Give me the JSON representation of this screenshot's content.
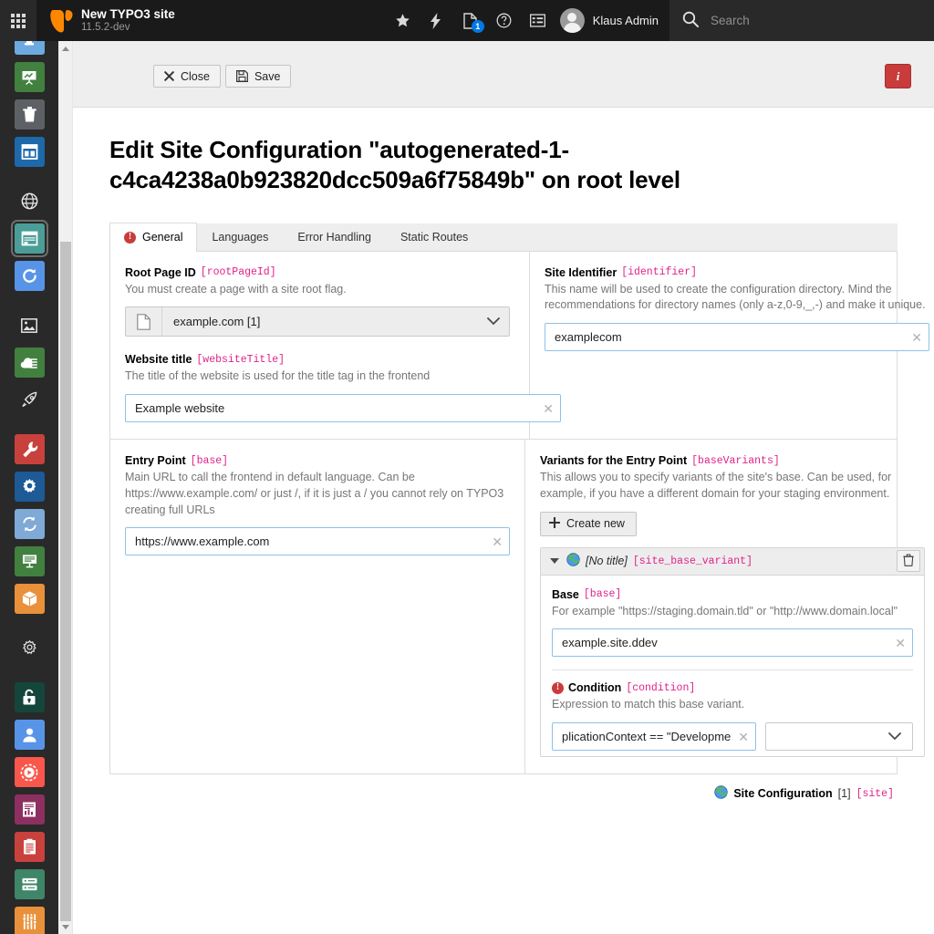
{
  "topbar": {
    "module_menu_icon": "grid-icon",
    "logo_icon": "typo3-logo-icon",
    "site_name": "New TYPO3 site",
    "version": "11.5.2-dev",
    "icons": [
      {
        "name": "bookmark-star-icon",
        "glyph": "star"
      },
      {
        "name": "flash-message-icon",
        "glyph": "bolt"
      },
      {
        "name": "clipboard-icon",
        "glyph": "document",
        "badge": "1"
      },
      {
        "name": "help-icon",
        "glyph": "question-circle"
      },
      {
        "name": "list-icon",
        "glyph": "list"
      }
    ],
    "user_name": "Klaus Admin",
    "avatar_name": "avatar",
    "search_icon": "search-icon",
    "search_placeholder": "Search",
    "search_value": ""
  },
  "modulemenu": {
    "items": [
      {
        "name": "module-web-page",
        "icon": "page-icon",
        "bg": "#6daae0",
        "active": false
      },
      {
        "name": "module-web-view",
        "icon": "presentation-icon",
        "bg": "#41803f",
        "active": false
      },
      {
        "name": "module-recycler",
        "icon": "trash-icon",
        "bg": "#5d6166",
        "active": false
      },
      {
        "name": "module-page-layout",
        "icon": "layout-icon",
        "bg": "#1d69aa",
        "active": false
      },
      {
        "name": "module-site-globe",
        "icon": "globe-icon",
        "bg": "transparent",
        "active": false
      },
      {
        "name": "module-site-management",
        "icon": "site-icon",
        "bg": "#4a9e97",
        "active": true
      },
      {
        "name": "module-redirects",
        "icon": "refresh-icon",
        "bg": "#5794e8",
        "active": false
      },
      {
        "name": "module-filelist-media",
        "icon": "image-icon",
        "bg": "transparent",
        "active": false
      },
      {
        "name": "module-filelist",
        "icon": "cloud-files-icon",
        "bg": "#41803f",
        "active": false
      },
      {
        "name": "module-upgrade",
        "icon": "rocket-icon",
        "bg": "transparent",
        "active": false
      },
      {
        "name": "module-maintenance",
        "icon": "wrench-icon",
        "bg": "#c9413d",
        "active": false
      },
      {
        "name": "module-settings",
        "icon": "gear-icon",
        "bg": "#1d5a96",
        "active": false
      },
      {
        "name": "module-upgrade-sync",
        "icon": "sync-icon",
        "bg": "#7fa9d6",
        "active": false
      },
      {
        "name": "module-environment",
        "icon": "server-form-icon",
        "bg": "#41803f",
        "active": false
      },
      {
        "name": "module-extensions",
        "icon": "package-icon",
        "bg": "#e8903a",
        "active": false
      },
      {
        "name": "module-system-settings",
        "icon": "cog-outline-icon",
        "bg": "transparent",
        "active": false
      },
      {
        "name": "module-access",
        "icon": "unlock-icon",
        "bg": "#14463c",
        "active": false
      },
      {
        "name": "module-backend-users",
        "icon": "user-icon",
        "bg": "#5794e8",
        "active": false
      },
      {
        "name": "module-scheduler",
        "icon": "play-circle-icon",
        "bg": "#f9574b",
        "active": false
      },
      {
        "name": "module-reports",
        "icon": "report-icon",
        "bg": "#8e2f61",
        "active": false
      },
      {
        "name": "module-log",
        "icon": "clipboard-list-icon",
        "bg": "#c9413d",
        "active": false
      },
      {
        "name": "module-db-check",
        "icon": "database-icon",
        "bg": "#3f8567",
        "active": false
      },
      {
        "name": "module-configuration",
        "icon": "sliders-icon",
        "bg": "#e8903a",
        "active": false
      }
    ]
  },
  "docheader": {
    "close_label": "Close",
    "close_icon": "close-x-icon",
    "save_label": "Save",
    "save_icon": "floppy-disk-icon",
    "info_label": "i",
    "info_name": "info-button"
  },
  "page_title": "Edit Site Configuration \"autogenerated-1-c4ca4238a0b923820dcc509a6f75849b\" on root level",
  "tabs": [
    {
      "label": "General",
      "active": true,
      "has_error": true,
      "error_glyph": "!"
    },
    {
      "label": "Languages",
      "active": false,
      "has_error": false
    },
    {
      "label": "Error Handling",
      "active": false,
      "has_error": false
    },
    {
      "label": "Static Routes",
      "active": false,
      "has_error": false
    }
  ],
  "fields": {
    "root_page_id": {
      "label": "Root Page ID",
      "key": "[rootPageId]",
      "description": "You must create a page with a site root flag.",
      "value": "example.com [1]",
      "icon": "page-document-icon",
      "caret_icon": "chevron-down-icon"
    },
    "site_identifier": {
      "label": "Site Identifier",
      "key": "[identifier]",
      "description": "This name will be used to create the configuration directory. Mind the recommendations for directory names (only a-z,0-9,_,-) and make it unique.",
      "value": "examplecom",
      "clear_icon": "clear-x-icon"
    },
    "website_title": {
      "label": "Website title",
      "key": "[websiteTitle]",
      "description": "The title of the website is used for the title tag in the frontend",
      "value": "Example website",
      "clear_icon": "clear-x-icon"
    },
    "entry_point": {
      "label": "Entry Point",
      "key": "[base]",
      "description": "Main URL to call the frontend in default language. Can be https://www.example.com/ or just /, if it is just a / you cannot rely on TYPO3 creating full URLs",
      "value": "https://www.example.com",
      "clear_icon": "clear-x-icon"
    },
    "base_variants": {
      "label": "Variants for the Entry Point",
      "key": "[baseVariants]",
      "description": "This allows you to specify variants of the site's base. Can be used, for example, if you have a different domain for your staging environment.",
      "create_label": "Create new",
      "create_icon": "plus-icon"
    }
  },
  "variant": {
    "collapse_icon": "caret-down-icon",
    "record_icon": "globe-icon",
    "title": "[No title]",
    "key": "[site_base_variant]",
    "delete_icon": "trash-icon",
    "base": {
      "label": "Base",
      "key": "[base]",
      "description": "For example \"https://staging.domain.tld\" or \"http://www.domain.local\"",
      "value": "example.site.ddev",
      "clear_icon": "clear-x-icon"
    },
    "condition": {
      "label": "Condition",
      "key": "[condition]",
      "error_glyph": "!",
      "error_icon": "error-exclamation-icon",
      "description": "Expression to match this base variant.",
      "value": "plicationContext == \"Development\"",
      "clear_icon": "clear-x-icon",
      "select_value": "",
      "select_caret_icon": "chevron-down-icon"
    }
  },
  "footer": {
    "record_icon": "globe-icon",
    "label": "Site Configuration",
    "count": "[1]",
    "key": "[site]"
  }
}
